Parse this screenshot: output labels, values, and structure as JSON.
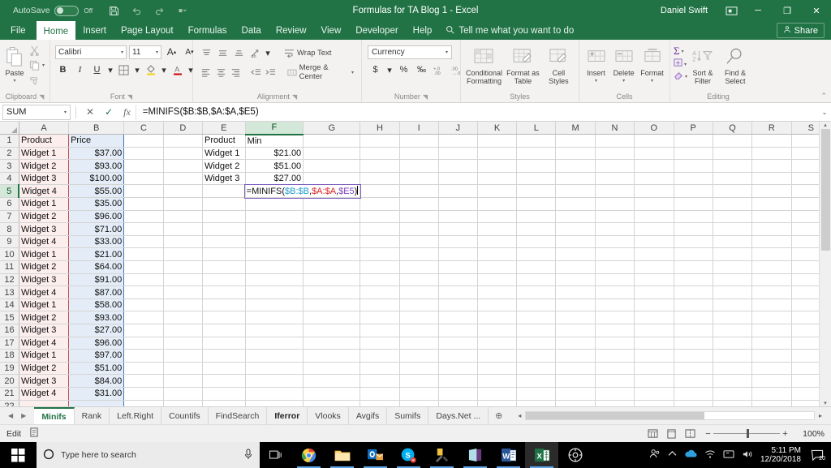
{
  "titlebar": {
    "autosave_label": "AutoSave",
    "autosave_state": "Off",
    "document_title": "Formulas for TA Blog 1 - Excel",
    "user_name": "Daniel Swift",
    "save_icon": "save-icon",
    "undo_icon": "undo-icon",
    "redo_icon": "redo-icon",
    "customize_qat_icon": "customize-quick-access-icon",
    "ribbon_display_icon": "ribbon-display-options-icon",
    "minimize_label": "─",
    "restore_label": "❐",
    "close_label": "✕"
  },
  "ribbon_tabs": [
    {
      "label": "File",
      "active": false
    },
    {
      "label": "Home",
      "active": true
    },
    {
      "label": "Insert",
      "active": false
    },
    {
      "label": "Page Layout",
      "active": false
    },
    {
      "label": "Formulas",
      "active": false
    },
    {
      "label": "Data",
      "active": false
    },
    {
      "label": "Review",
      "active": false
    },
    {
      "label": "View",
      "active": false
    },
    {
      "label": "Developer",
      "active": false
    },
    {
      "label": "Help",
      "active": false
    }
  ],
  "tellme": {
    "placeholder": "Tell me what you want to do",
    "icon": "search-icon"
  },
  "share": {
    "label": "Share",
    "icon": "share-person-icon"
  },
  "ribbon": {
    "clipboard": {
      "group_label": "Clipboard",
      "paste_label": "Paste",
      "cut_label": "Cut",
      "copy_label": "Copy",
      "format_painter_label": "Format Painter"
    },
    "font": {
      "group_label": "Font",
      "font_name": "Calibri",
      "font_size": "11",
      "grow_label": "A",
      "shrink_label": "A",
      "bold_label": "B",
      "italic_label": "I",
      "underline_label": "U",
      "borders_label": "Borders",
      "fill_color_label": "Fill Color",
      "font_color_label": "A"
    },
    "alignment": {
      "group_label": "Alignment",
      "wrap_text_label": "Wrap Text",
      "merge_center_label": "Merge & Center",
      "orientation_label": "Orientation"
    },
    "number": {
      "group_label": "Number",
      "format_value": "Currency",
      "accounting_label": "$",
      "percent_label": "%",
      "comma_label": "‰",
      "increase_decimal_label": "Increase Decimal",
      "decrease_decimal_label": "Decrease Decimal"
    },
    "styles": {
      "group_label": "Styles",
      "items": [
        {
          "line1": "Conditional",
          "line2": "Formatting"
        },
        {
          "line1": "Format as",
          "line2": "Table"
        },
        {
          "line1": "Cell",
          "line2": "Styles"
        }
      ]
    },
    "cells": {
      "group_label": "Cells",
      "items": [
        {
          "label": "Insert"
        },
        {
          "label": "Delete"
        },
        {
          "label": "Format"
        }
      ]
    },
    "editing": {
      "group_label": "Editing",
      "autosum_label": "Σ",
      "fill_label": "Fill",
      "clear_label": "Clear",
      "sort_filter_line1": "Sort &",
      "sort_filter_line2": "Filter",
      "find_select_line1": "Find &",
      "find_select_line2": "Select"
    },
    "collapse_label": "⌃"
  },
  "formula_bar": {
    "name_box": "SUM",
    "cancel_label": "✕",
    "enter_label": "✓",
    "insert_function_label": "fx",
    "formula": "=MINIFS($B:$B,$A:$A,$E5)",
    "expand_label": "⌄"
  },
  "grid": {
    "columns": [
      "A",
      "B",
      "C",
      "D",
      "E",
      "F",
      "G",
      "H",
      "I",
      "J",
      "K",
      "L",
      "M",
      "N",
      "O",
      "P",
      "Q",
      "R",
      "S"
    ],
    "selected_column": "F",
    "selected_row": 5,
    "rows": [
      {
        "n": 1,
        "A": "Product",
        "B": "Price",
        "E": "Product",
        "F": "Min"
      },
      {
        "n": 2,
        "A": "Widget 1",
        "B": "$37.00",
        "E": "Widget 1",
        "F": "$21.00"
      },
      {
        "n": 3,
        "A": "Widget 2",
        "B": "$93.00",
        "E": "Widget 2",
        "F": "$51.00"
      },
      {
        "n": 4,
        "A": "Widget 3",
        "B": "$100.00",
        "E": "Widget 3",
        "F": "$27.00"
      },
      {
        "n": 5,
        "A": "Widget 4",
        "B": "$55.00",
        "E": "",
        "F": "__EDIT__"
      },
      {
        "n": 6,
        "A": "Widget 1",
        "B": "$35.00",
        "E": "",
        "F": ""
      },
      {
        "n": 7,
        "A": "Widget 2",
        "B": "$96.00",
        "E": "",
        "F": ""
      },
      {
        "n": 8,
        "A": "Widget 3",
        "B": "$71.00",
        "E": "",
        "F": ""
      },
      {
        "n": 9,
        "A": "Widget 4",
        "B": "$33.00",
        "E": "",
        "F": ""
      },
      {
        "n": 10,
        "A": "Widget 1",
        "B": "$21.00",
        "E": "",
        "F": ""
      },
      {
        "n": 11,
        "A": "Widget 2",
        "B": "$64.00",
        "E": "",
        "F": ""
      },
      {
        "n": 12,
        "A": "Widget 3",
        "B": "$91.00",
        "E": "",
        "F": ""
      },
      {
        "n": 13,
        "A": "Widget 4",
        "B": "$87.00",
        "E": "",
        "F": ""
      },
      {
        "n": 14,
        "A": "Widget 1",
        "B": "$58.00",
        "E": "",
        "F": ""
      },
      {
        "n": 15,
        "A": "Widget 2",
        "B": "$93.00",
        "E": "",
        "F": ""
      },
      {
        "n": 16,
        "A": "Widget 3",
        "B": "$27.00",
        "E": "",
        "F": ""
      },
      {
        "n": 17,
        "A": "Widget 4",
        "B": "$96.00",
        "E": "",
        "F": ""
      },
      {
        "n": 18,
        "A": "Widget 1",
        "B": "$97.00",
        "E": "",
        "F": ""
      },
      {
        "n": 19,
        "A": "Widget 2",
        "B": "$51.00",
        "E": "",
        "F": ""
      },
      {
        "n": 20,
        "A": "Widget 3",
        "B": "$84.00",
        "E": "",
        "F": ""
      },
      {
        "n": 21,
        "A": "Widget 4",
        "B": "$31.00",
        "E": "",
        "F": ""
      },
      {
        "n": 22,
        "A": "",
        "B": "",
        "E": "",
        "F": ""
      }
    ],
    "edit_formula": {
      "prefix": "=MINIFS(",
      "ref1": "$B:$B",
      "sep1": ",",
      "ref2": "$A:$A",
      "sep2": ",",
      "ref3": "$E5",
      "suffix": ")"
    },
    "colors": {
      "ref1": "#1f9bd4",
      "ref2": "#e02020",
      "ref3": "#7f3fbf",
      "column_a_highlight": "#fdeeee",
      "column_b_highlight": "#e4edf7",
      "accent_green": "#217346"
    }
  },
  "sheet_tabs": {
    "first_label": "◀◀",
    "prev_label": "◀",
    "next_label": "▶",
    "last_label": "▶▶",
    "add_label": "⊕",
    "tabs": [
      {
        "label": "Minifs",
        "active": true,
        "bold": true
      },
      {
        "label": "Rank",
        "active": false,
        "bold": false
      },
      {
        "label": "Left.Right",
        "active": false,
        "bold": false
      },
      {
        "label": "Countifs",
        "active": false,
        "bold": false
      },
      {
        "label": "FindSearch",
        "active": false,
        "bold": false
      },
      {
        "label": "Iferror",
        "active": false,
        "bold": true
      },
      {
        "label": "Vlooks",
        "active": false,
        "bold": false
      },
      {
        "label": "Avgifs",
        "active": false,
        "bold": false
      },
      {
        "label": "Sumifs",
        "active": false,
        "bold": false
      },
      {
        "label": "Days.Net ...",
        "active": false,
        "bold": false
      }
    ]
  },
  "status_bar": {
    "mode": "Edit",
    "accessibility_icon": "accessibility-checker-icon",
    "normal_view_icon": "normal-view-icon",
    "page_layout_icon": "page-layout-view-icon",
    "page_break_icon": "page-break-preview-icon",
    "zoom_out_label": "−",
    "zoom_in_label": "+",
    "zoom_value": "100%"
  },
  "taskbar": {
    "start_label": "Start",
    "search_placeholder": "Type here to search",
    "cortana_icon": "cortana-circle-icon",
    "microphone_icon": "microphone-icon",
    "task_view_icon": "task-view-icon",
    "apps": [
      {
        "name": "chrome",
        "open": true
      },
      {
        "name": "file-explorer",
        "open": true
      },
      {
        "name": "outlook",
        "open": true
      },
      {
        "name": "skype",
        "open": true
      },
      {
        "name": "snip-tool",
        "open": true
      },
      {
        "name": "onenote",
        "open": true
      },
      {
        "name": "word",
        "open": true
      },
      {
        "name": "excel",
        "open": true,
        "active": true
      },
      {
        "name": "settings",
        "open": false
      }
    ],
    "tray": {
      "people_icon": "people-icon",
      "chevron_icon": "show-hidden-icons-icon",
      "onedrive_icon": "onedrive-icon",
      "network_icon": "network-icon",
      "action_icon": "action-center-icon",
      "volume_icon": "volume-icon",
      "time": "5:11 PM",
      "date": "12/20/2018",
      "notification_count": "20"
    }
  }
}
